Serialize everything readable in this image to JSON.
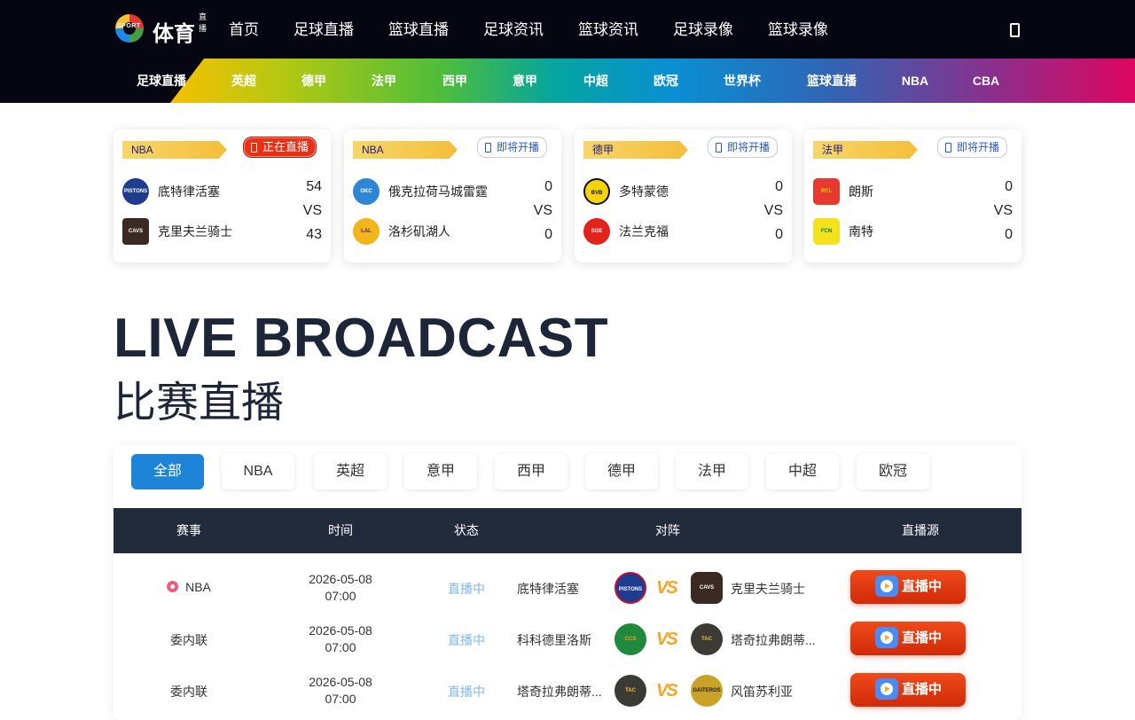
{
  "header": {
    "logo_text": "体育",
    "logo_badge": "直播",
    "logo_sport": "SPORT",
    "nav": [
      "首页",
      "足球直播",
      "篮球直播",
      "足球资讯",
      "篮球资讯",
      "足球录像",
      "篮球录像"
    ],
    "phone_icon": "mobile-phone-icon"
  },
  "subnav": [
    "足球直播",
    "英超",
    "德甲",
    "法甲",
    "西甲",
    "意甲",
    "中超",
    "欧冠",
    "世界杯",
    "篮球直播",
    "NBA",
    "CBA"
  ],
  "cards": [
    {
      "league": "NBA",
      "status": "正在直播",
      "status_type": "live",
      "home": {
        "name": "底特律活塞",
        "score": "54",
        "logo": "PISTONS",
        "color": "#1d3b8f"
      },
      "away": {
        "name": "克里夫兰骑士",
        "score": "43",
        "logo": "CAVS",
        "color": "#3a2a22"
      },
      "vs": "VS"
    },
    {
      "league": "NBA",
      "status": "即将开播",
      "status_type": "soon",
      "home": {
        "name": "俄克拉荷马城雷霆",
        "score": "0",
        "logo": "OKC",
        "color": "#2f86d6"
      },
      "away": {
        "name": "洛杉矶湖人",
        "score": "0",
        "logo": "LAL",
        "color": "#f2b51a"
      },
      "vs": "VS"
    },
    {
      "league": "德甲",
      "status": "即将开播",
      "status_type": "soon",
      "home": {
        "name": "多特蒙德",
        "score": "0",
        "logo": "BVB",
        "color": "#f6d30a"
      },
      "away": {
        "name": "法兰克福",
        "score": "0",
        "logo": "SGE",
        "color": "#e1231c"
      },
      "vs": "VS"
    },
    {
      "league": "法甲",
      "status": "即将开播",
      "status_type": "soon",
      "home": {
        "name": "朗斯",
        "score": "0",
        "logo": "RCL",
        "color": "#e8392e"
      },
      "away": {
        "name": "南特",
        "score": "0",
        "logo": "FCN",
        "color": "#f3e21c"
      },
      "vs": "VS"
    }
  ],
  "heading": {
    "en": "LIVE BROADCAST",
    "zh": "比赛直播"
  },
  "filters": [
    "全部",
    "NBA",
    "英超",
    "意甲",
    "西甲",
    "德甲",
    "法甲",
    "中超",
    "欧冠"
  ],
  "table": {
    "headers": [
      "赛事",
      "时间",
      "状态",
      "对阵",
      "直播源"
    ],
    "rows": [
      {
        "league": "NBA",
        "hot": true,
        "date": "2026-05-08",
        "time": "07:00",
        "status": "直播中",
        "home": "底特律活塞",
        "home_logo": "PISTONS",
        "home_color": "#1d3b8f",
        "away": "克里夫兰骑士",
        "away_logo": "CAVS",
        "away_color": "#3a2a22",
        "button": "直播中"
      },
      {
        "league": "委内联",
        "hot": false,
        "date": "2026-05-08",
        "time": "07:00",
        "status": "直播中",
        "home": "科科德里洛斯",
        "home_logo": "CCS",
        "home_color": "#1f8a3c",
        "away": "塔奇拉弗朗蒂...",
        "away_logo": "TAC",
        "away_color": "#3b3a34",
        "button": "直播中"
      },
      {
        "league": "委内联",
        "hot": false,
        "date": "2026-05-08",
        "time": "07:00",
        "status": "直播中",
        "home": "塔奇拉弗朗蒂...",
        "home_logo": "TAC",
        "home_color": "#3b3a34",
        "away": "风笛苏利亚",
        "away_logo": "GAITEROS",
        "away_color": "#c9a227",
        "button": "直播中"
      }
    ],
    "vs_mark": "VS"
  }
}
